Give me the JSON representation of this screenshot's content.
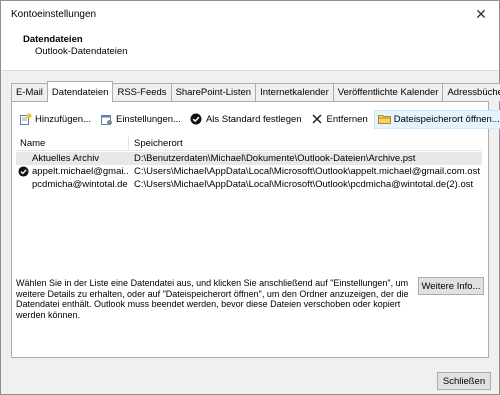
{
  "window": {
    "title": "Kontoeinstellungen",
    "close_glyph": "✕"
  },
  "header": {
    "title": "Datendateien",
    "subtitle": "Outlook-Datendateien"
  },
  "tabs": [
    {
      "label": "E-Mail",
      "active": false
    },
    {
      "label": "Datendateien",
      "active": true
    },
    {
      "label": "RSS-Feeds",
      "active": false
    },
    {
      "label": "SharePoint-Listen",
      "active": false
    },
    {
      "label": "Internetkalender",
      "active": false
    },
    {
      "label": "Veröffentlichte Kalender",
      "active": false
    },
    {
      "label": "Adressbücher",
      "active": false
    }
  ],
  "toolbar": {
    "add": "Hinzufügen...",
    "settings": "Einstellungen...",
    "default": "Als Standard festlegen",
    "remove": "Entfernen",
    "open_location": "Dateispeicherort öffnen..."
  },
  "list": {
    "col_name": "Name",
    "col_location": "Speicherort",
    "rows": [
      {
        "name": "Aktuelles Archiv",
        "location": "D:\\Benutzerdaten\\Michael\\Dokumente\\Outlook-Dateien\\Archive.pst",
        "default": false,
        "selected": true
      },
      {
        "name": "appelt.michael@gmai...",
        "location": "C:\\Users\\Michael\\AppData\\Local\\Microsoft\\Outlook\\appelt.michael@gmail.com.ost",
        "default": true,
        "selected": false
      },
      {
        "name": "pcdmicha@wintotal.de",
        "location": "C:\\Users\\Michael\\AppData\\Local\\Microsoft\\Outlook\\pcdmicha@wintotal.de(2).ost",
        "default": false,
        "selected": false
      }
    ]
  },
  "info_text": "Wählen Sie in der Liste eine Datendatei aus, und klicken Sie anschließend auf \"Einstellungen\", um weitere Details zu erhalten, oder auf \"Dateispeicherort öffnen\", um den Ordner anzuzeigen, der die Datendatei enthält. Outlook muss beendet werden, bevor diese Dateien verschoben oder kopiert werden können.",
  "buttons": {
    "more_info": "Weitere Info...",
    "close": "Schließen"
  }
}
